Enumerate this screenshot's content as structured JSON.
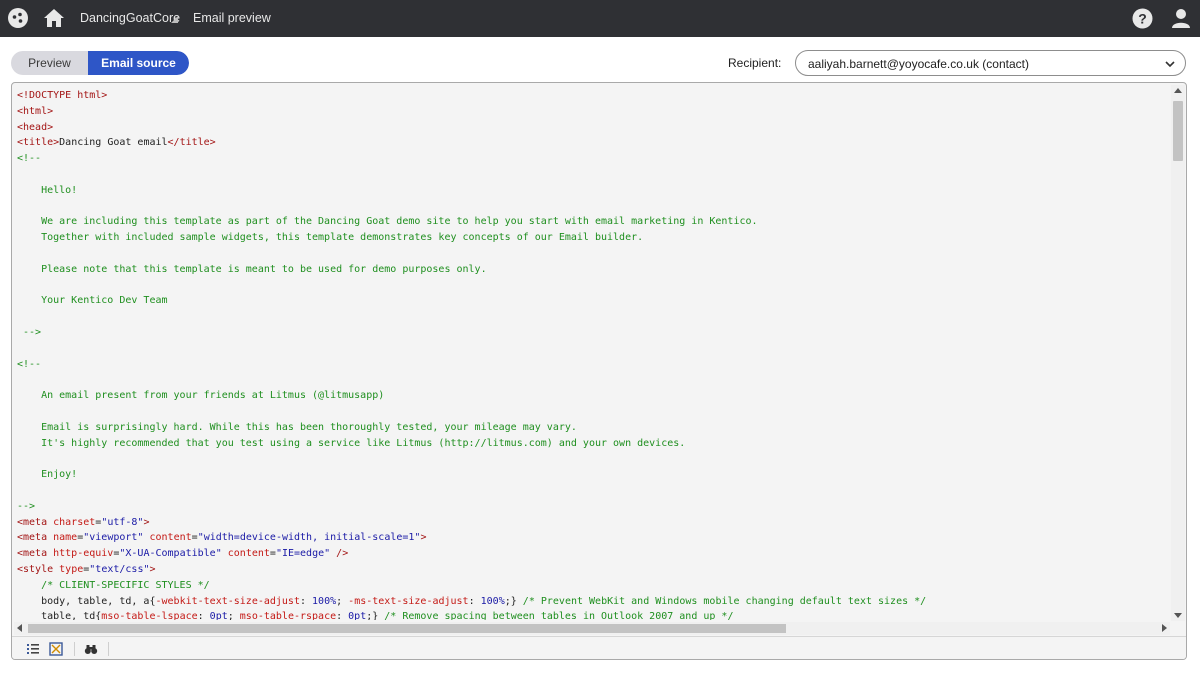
{
  "topbar": {
    "site_name": "DancingGoatCore",
    "app_name": "Email preview",
    "icons": [
      "app-logo-icon",
      "home-icon",
      "site-caret-icon",
      "help-icon",
      "user-icon"
    ]
  },
  "toolbar": {
    "preview_label": "Preview",
    "source_label": "Email source",
    "recipient_label": "Recipient:",
    "recipient_value": "aaliyah.barnett@yoyocafe.co.uk (contact)"
  },
  "colors": {
    "topbar": "#2f3034",
    "accent": "#2e56c7",
    "tag": "#a31515",
    "attr_value": "#1a1aa6",
    "comment": "#1f8f1f"
  },
  "code_lines": [
    [
      [
        "t",
        "<!DOCTYPE html>"
      ]
    ],
    [
      [
        "t",
        "<html>"
      ]
    ],
    [
      [
        "t",
        "<head>"
      ]
    ],
    [
      [
        "t",
        "<title>"
      ],
      [
        "p",
        "Dancing Goat email"
      ],
      [
        "t",
        "</title>"
      ]
    ],
    [
      [
        "c",
        "<!--"
      ]
    ],
    [
      [
        "c",
        ""
      ]
    ],
    [
      [
        "c",
        "    Hello!"
      ]
    ],
    [
      [
        "c",
        ""
      ]
    ],
    [
      [
        "c",
        "    We are including this template as part of the Dancing Goat demo site to help you start with email marketing in Kentico."
      ]
    ],
    [
      [
        "c",
        "    Together with included sample widgets, this template demonstrates key concepts of our Email builder."
      ]
    ],
    [
      [
        "c",
        ""
      ]
    ],
    [
      [
        "c",
        "    Please note that this template is meant to be used for demo purposes only."
      ]
    ],
    [
      [
        "c",
        ""
      ]
    ],
    [
      [
        "c",
        "    Your Kentico Dev Team"
      ]
    ],
    [
      [
        "c",
        ""
      ]
    ],
    [
      [
        "c",
        " -->"
      ]
    ],
    [
      [
        "c",
        ""
      ]
    ],
    [
      [
        "c",
        "<!--"
      ]
    ],
    [
      [
        "c",
        ""
      ]
    ],
    [
      [
        "c",
        "    An email present from your friends at Litmus (@litmusapp)"
      ]
    ],
    [
      [
        "c",
        ""
      ]
    ],
    [
      [
        "c",
        "    Email is surprisingly hard. While this has been thoroughly tested, your mileage may vary."
      ]
    ],
    [
      [
        "c",
        "    It's highly recommended that you test using a service like Litmus (http://litmus.com) and your own devices."
      ]
    ],
    [
      [
        "c",
        ""
      ]
    ],
    [
      [
        "c",
        "    Enjoy!"
      ]
    ],
    [
      [
        "c",
        ""
      ]
    ],
    [
      [
        "c",
        "-->"
      ]
    ],
    [
      [
        "t",
        "<meta "
      ],
      [
        "a",
        "charset"
      ],
      [
        "p",
        "="
      ],
      [
        "v",
        "\"utf-8\""
      ],
      [
        "t",
        ">"
      ]
    ],
    [
      [
        "t",
        "<meta "
      ],
      [
        "a",
        "name"
      ],
      [
        "p",
        "="
      ],
      [
        "v",
        "\"viewport\""
      ],
      [
        "p",
        " "
      ],
      [
        "a",
        "content"
      ],
      [
        "p",
        "="
      ],
      [
        "v",
        "\"width=device-width, initial-scale=1\""
      ],
      [
        "t",
        ">"
      ]
    ],
    [
      [
        "t",
        "<meta "
      ],
      [
        "a",
        "http-equiv"
      ],
      [
        "p",
        "="
      ],
      [
        "v",
        "\"X-UA-Compatible\""
      ],
      [
        "p",
        " "
      ],
      [
        "a",
        "content"
      ],
      [
        "p",
        "="
      ],
      [
        "v",
        "\"IE=edge\""
      ],
      [
        "p",
        " "
      ],
      [
        "t",
        "/>"
      ]
    ],
    [
      [
        "t",
        "<style "
      ],
      [
        "a",
        "type"
      ],
      [
        "p",
        "="
      ],
      [
        "v",
        "\"text/css\""
      ],
      [
        "t",
        ">"
      ]
    ],
    [
      [
        "c",
        "    /* CLIENT-SPECIFIC STYLES */"
      ]
    ],
    [
      [
        "p",
        "    body, table, td, a{"
      ],
      [
        "a",
        "-webkit-text-size-adjust"
      ],
      [
        "p",
        ": "
      ],
      [
        "v",
        "100%"
      ],
      [
        "p",
        "; "
      ],
      [
        "a",
        "-ms-text-size-adjust"
      ],
      [
        "p",
        ": "
      ],
      [
        "v",
        "100%"
      ],
      [
        "p",
        ";} "
      ],
      [
        "c",
        "/* Prevent WebKit and Windows mobile changing default text sizes */"
      ]
    ],
    [
      [
        "p",
        "    table, td{"
      ],
      [
        "a",
        "mso-table-lspace"
      ],
      [
        "p",
        ": "
      ],
      [
        "v",
        "0pt"
      ],
      [
        "p",
        "; "
      ],
      [
        "a",
        "mso-table-rspace"
      ],
      [
        "p",
        ": "
      ],
      [
        "v",
        "0pt"
      ],
      [
        "p",
        ";} "
      ],
      [
        "c",
        "/* Remove spacing between tables in Outlook 2007 and up */"
      ]
    ]
  ]
}
